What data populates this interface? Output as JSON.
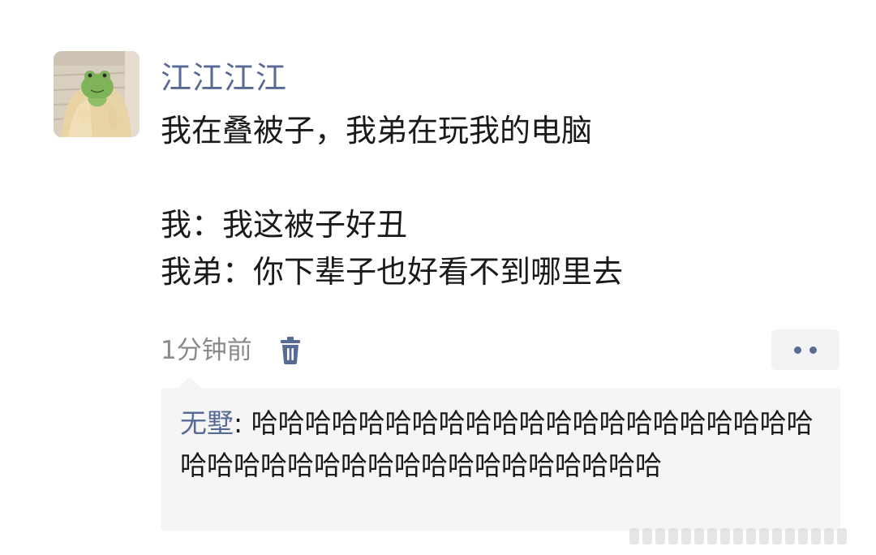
{
  "post": {
    "author": "江江江江",
    "content_lines": [
      "我在叠被子，我弟在玩我的电脑",
      "",
      "我：我这被子好丑",
      "我弟：你下辈子也好看不到哪里去"
    ],
    "time": "1分钟前",
    "icons": {
      "delete": "trash-icon",
      "more": "more-dots-icon"
    }
  },
  "comments": [
    {
      "name": "无墅",
      "separator": ": ",
      "text": "哈哈哈哈哈哈哈哈哈哈哈哈哈哈哈哈哈哈哈哈哈哈哈哈哈哈哈哈哈哈哈哈哈哈哈哈哈哈哈"
    }
  ],
  "colors": {
    "link": "#576b95",
    "text": "#1a1a1a",
    "meta": "#8a8a8a",
    "comment_bg": "#f5f5f6"
  }
}
